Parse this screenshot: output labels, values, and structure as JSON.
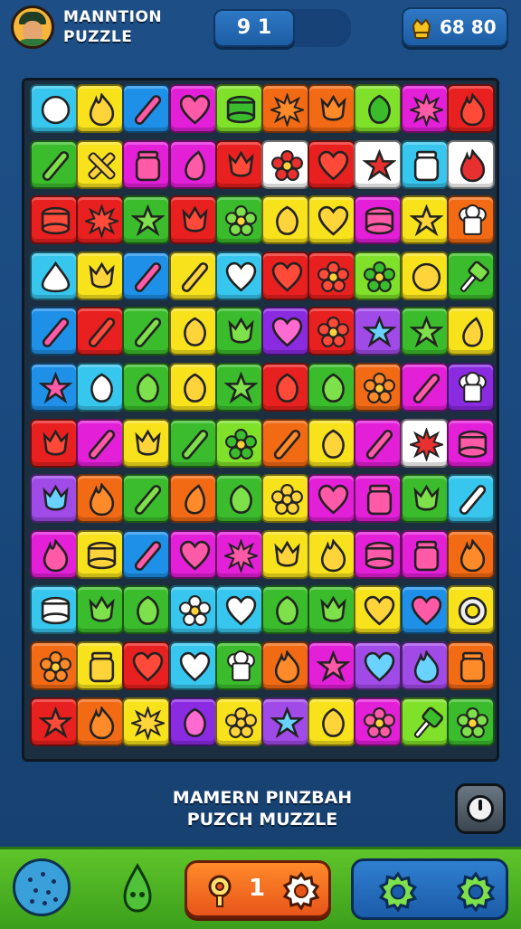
{
  "header": {
    "title_line1": "MANNTION",
    "title_line2": "PUZZLE",
    "score": "9 1",
    "coins": "68 80"
  },
  "caption": {
    "line1": "MAMERN PINZBAH",
    "line2": "PUZCH MUZZLE"
  },
  "bottom": {
    "counter": "1"
  },
  "icons": {
    "avatar": "avatar",
    "coin": "crown-coin-icon",
    "side_button": "power-icon",
    "cookie": "cookie-icon",
    "drop": "drop-creature-icon",
    "gear": "gear-icon"
  },
  "colors": {
    "red": "#e8201f",
    "orange": "#f26a14",
    "yellow": "#f7e21c",
    "green": "#3bbc2c",
    "blue": "#1e90e8",
    "cyan": "#37c6ee",
    "purple": "#8a2be2",
    "magenta": "#e31fd8",
    "pink": "#f03a8a",
    "white": "#ffffff",
    "lime": "#7fe12a",
    "violet": "#a04ae8"
  },
  "board": {
    "rows": 12,
    "cols": 10,
    "tiles": [
      [
        {
          "bg": "cyan",
          "icon": "bag"
        },
        {
          "bg": "yellow",
          "icon": "flame"
        },
        {
          "bg": "blue",
          "icon": "stick"
        },
        {
          "bg": "magenta",
          "icon": "heart"
        },
        {
          "bg": "lime",
          "icon": "cake"
        },
        {
          "bg": "orange",
          "icon": "burst"
        },
        {
          "bg": "orange",
          "icon": "tulip"
        },
        {
          "bg": "lime",
          "icon": "leaf"
        },
        {
          "bg": "magenta",
          "icon": "burst"
        },
        {
          "bg": "red",
          "icon": "flame"
        }
      ],
      [
        {
          "bg": "green",
          "icon": "stick"
        },
        {
          "bg": "yellow",
          "icon": "cross"
        },
        {
          "bg": "magenta",
          "icon": "jar"
        },
        {
          "bg": "magenta",
          "icon": "drop"
        },
        {
          "bg": "red",
          "icon": "tulip"
        },
        {
          "bg": "white",
          "icon": "flower"
        },
        {
          "bg": "red",
          "icon": "heart"
        },
        {
          "bg": "white",
          "icon": "star"
        },
        {
          "bg": "cyan",
          "icon": "jar"
        },
        {
          "bg": "white",
          "icon": "flame"
        }
      ],
      [
        {
          "bg": "red",
          "icon": "cake"
        },
        {
          "bg": "red",
          "icon": "burst"
        },
        {
          "bg": "green",
          "icon": "star"
        },
        {
          "bg": "red",
          "icon": "tulip"
        },
        {
          "bg": "green",
          "icon": "flower"
        },
        {
          "bg": "yellow",
          "icon": "leaf"
        },
        {
          "bg": "yellow",
          "icon": "heart"
        },
        {
          "bg": "magenta",
          "icon": "cake"
        },
        {
          "bg": "yellow",
          "icon": "star"
        },
        {
          "bg": "orange",
          "icon": "chef"
        }
      ],
      [
        {
          "bg": "cyan",
          "icon": "cream"
        },
        {
          "bg": "yellow",
          "icon": "tulip"
        },
        {
          "bg": "blue",
          "icon": "stick"
        },
        {
          "bg": "yellow",
          "icon": "stick"
        },
        {
          "bg": "cyan",
          "icon": "heart"
        },
        {
          "bg": "red",
          "icon": "heart"
        },
        {
          "bg": "red",
          "icon": "flower"
        },
        {
          "bg": "lime",
          "icon": "flower"
        },
        {
          "bg": "yellow",
          "icon": "ball"
        },
        {
          "bg": "green",
          "icon": "lolly"
        }
      ],
      [
        {
          "bg": "blue",
          "icon": "stick"
        },
        {
          "bg": "red",
          "icon": "stick"
        },
        {
          "bg": "green",
          "icon": "stick"
        },
        {
          "bg": "yellow",
          "icon": "leaf"
        },
        {
          "bg": "green",
          "icon": "tulip"
        },
        {
          "bg": "purple",
          "icon": "heart"
        },
        {
          "bg": "red",
          "icon": "flower"
        },
        {
          "bg": "violet",
          "icon": "star"
        },
        {
          "bg": "green",
          "icon": "star"
        },
        {
          "bg": "yellow",
          "icon": "drop"
        }
      ],
      [
        {
          "bg": "blue",
          "icon": "star"
        },
        {
          "bg": "cyan",
          "icon": "leaf"
        },
        {
          "bg": "green",
          "icon": "leaf"
        },
        {
          "bg": "yellow",
          "icon": "leaf"
        },
        {
          "bg": "green",
          "icon": "star"
        },
        {
          "bg": "red",
          "icon": "leaf"
        },
        {
          "bg": "green",
          "icon": "leaf"
        },
        {
          "bg": "orange",
          "icon": "flower"
        },
        {
          "bg": "magenta",
          "icon": "stick"
        },
        {
          "bg": "purple",
          "icon": "chef"
        }
      ],
      [
        {
          "bg": "red",
          "icon": "tulip"
        },
        {
          "bg": "magenta",
          "icon": "stick"
        },
        {
          "bg": "yellow",
          "icon": "tulip"
        },
        {
          "bg": "green",
          "icon": "stick"
        },
        {
          "bg": "lime",
          "icon": "flower"
        },
        {
          "bg": "orange",
          "icon": "stick"
        },
        {
          "bg": "yellow",
          "icon": "leaf"
        },
        {
          "bg": "magenta",
          "icon": "stick"
        },
        {
          "bg": "white",
          "icon": "burst"
        },
        {
          "bg": "magenta",
          "icon": "cake"
        }
      ],
      [
        {
          "bg": "violet",
          "icon": "tulip"
        },
        {
          "bg": "orange",
          "icon": "flame"
        },
        {
          "bg": "green",
          "icon": "stick"
        },
        {
          "bg": "orange",
          "icon": "drop"
        },
        {
          "bg": "green",
          "icon": "leaf"
        },
        {
          "bg": "yellow",
          "icon": "flower"
        },
        {
          "bg": "magenta",
          "icon": "heart"
        },
        {
          "bg": "magenta",
          "icon": "jar"
        },
        {
          "bg": "green",
          "icon": "tulip"
        },
        {
          "bg": "cyan",
          "icon": "stick"
        }
      ],
      [
        {
          "bg": "magenta",
          "icon": "flame"
        },
        {
          "bg": "yellow",
          "icon": "cake"
        },
        {
          "bg": "blue",
          "icon": "stick"
        },
        {
          "bg": "magenta",
          "icon": "heart"
        },
        {
          "bg": "magenta",
          "icon": "burst"
        },
        {
          "bg": "yellow",
          "icon": "tulip"
        },
        {
          "bg": "yellow",
          "icon": "flame"
        },
        {
          "bg": "magenta",
          "icon": "cake"
        },
        {
          "bg": "magenta",
          "icon": "jar"
        },
        {
          "bg": "orange",
          "icon": "flame"
        }
      ],
      [
        {
          "bg": "cyan",
          "icon": "cake"
        },
        {
          "bg": "green",
          "icon": "tulip"
        },
        {
          "bg": "green",
          "icon": "leaf"
        },
        {
          "bg": "cyan",
          "icon": "flower"
        },
        {
          "bg": "cyan",
          "icon": "heart"
        },
        {
          "bg": "green",
          "icon": "leaf"
        },
        {
          "bg": "green",
          "icon": "tulip"
        },
        {
          "bg": "yellow",
          "icon": "heart"
        },
        {
          "bg": "blue",
          "icon": "heart"
        },
        {
          "bg": "yellow",
          "icon": "ring"
        }
      ],
      [
        {
          "bg": "orange",
          "icon": "flower"
        },
        {
          "bg": "yellow",
          "icon": "jar"
        },
        {
          "bg": "red",
          "icon": "heart"
        },
        {
          "bg": "cyan",
          "icon": "heart"
        },
        {
          "bg": "green",
          "icon": "chef"
        },
        {
          "bg": "orange",
          "icon": "flame"
        },
        {
          "bg": "magenta",
          "icon": "star"
        },
        {
          "bg": "violet",
          "icon": "heart"
        },
        {
          "bg": "violet",
          "icon": "flame"
        },
        {
          "bg": "orange",
          "icon": "jar"
        }
      ],
      [
        {
          "bg": "red",
          "icon": "star"
        },
        {
          "bg": "orange",
          "icon": "flame"
        },
        {
          "bg": "yellow",
          "icon": "burst"
        },
        {
          "bg": "purple",
          "icon": "leaf"
        },
        {
          "bg": "yellow",
          "icon": "flower"
        },
        {
          "bg": "violet",
          "icon": "star"
        },
        {
          "bg": "yellow",
          "icon": "leaf"
        },
        {
          "bg": "magenta",
          "icon": "flower"
        },
        {
          "bg": "lime",
          "icon": "lolly"
        },
        {
          "bg": "green",
          "icon": "flower"
        }
      ]
    ]
  }
}
